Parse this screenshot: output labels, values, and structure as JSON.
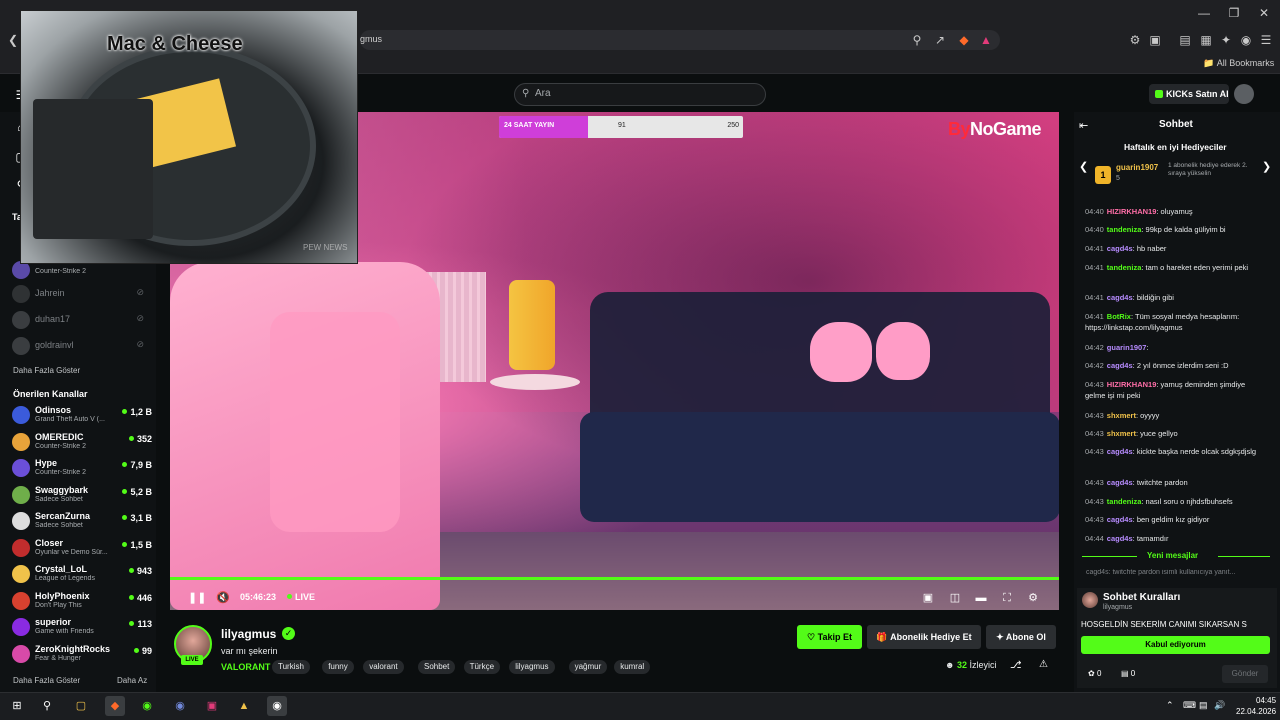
{
  "browser": {
    "url": "kick.com/lilyagmus",
    "url_visible": "gmus",
    "bookmarks_label": "All Bookmarks",
    "window_controls": [
      "minimize-icon",
      "restore-icon",
      "close-icon"
    ]
  },
  "topnav": {
    "search_placeholder": "Ara",
    "kicks_button": "KICKs Satın Al"
  },
  "pip": {
    "title": "Mac & Cheese",
    "watermark": "PEW NEWS"
  },
  "sidebar": {
    "following_header": "Ta",
    "following": [
      {
        "name": "",
        "category": "Counter-Strike 2",
        "live": true
      },
      {
        "name": "Jahrein",
        "live": false
      },
      {
        "name": "duhan17",
        "live": false
      },
      {
        "name": "goldrainvl",
        "live": false
      }
    ],
    "show_more": "Daha Fazla Göster",
    "recommended_header": "Önerilen Kanallar",
    "recommended": [
      {
        "name": "Odinsos",
        "category": "Grand Theft Auto V (...",
        "viewers": "1,2 B",
        "color": "#3b5bdb"
      },
      {
        "name": "OMEREDIC",
        "category": "Counter-Strike 2",
        "viewers": "352",
        "color": "#e8a33a"
      },
      {
        "name": "Hype",
        "category": "Counter-Strike 2",
        "viewers": "7,9 B",
        "color": "#6b4fd8"
      },
      {
        "name": "Swaggybark",
        "category": "Sadece Sohbet",
        "viewers": "5,2 B",
        "color": "#6fae4a"
      },
      {
        "name": "SercanZurna",
        "category": "Sadece Sohbet",
        "viewers": "3,1 B",
        "color": "#dddddd"
      },
      {
        "name": "Closer",
        "category": "Oyunlar ve Demo Sür...",
        "viewers": "1,5 B",
        "color": "#c22d2d"
      },
      {
        "name": "Crystal_LoL",
        "category": "League of Legends",
        "viewers": "943",
        "color": "#f0c24a"
      },
      {
        "name": "HolyPhoenix",
        "category": "Don't Play This",
        "viewers": "446",
        "color": "#d8412f"
      },
      {
        "name": "superior",
        "category": "Game with Friends",
        "viewers": "113",
        "color": "#8a2be2"
      },
      {
        "name": "ZeroKnightRocks",
        "category": "Fear & Hunger",
        "viewers": "99",
        "color": "#d84aa8"
      }
    ],
    "show_more_bottom": "Daha Fazla Göster",
    "show_less": "Daha Az"
  },
  "video": {
    "brand_prefix": "By",
    "brand_suffix": "NoGame",
    "goal": {
      "title": "24 SAAT YAYIN",
      "current": 91,
      "max": 250,
      "current_label": "91",
      "max_label": "250"
    },
    "time": "05:46:23",
    "live": "LIVE"
  },
  "channel": {
    "name": "lilyagmus",
    "title": "var mı şekerin",
    "game": "VALORANT",
    "live_badge": "LIVE",
    "tags": [
      "Turkish",
      "funny",
      "valorant",
      "Sohbet",
      "Türkçe",
      "lilyagmus",
      "yağmur",
      "kumral"
    ],
    "follow": "Takip Et",
    "gift": "Abonelik Hediye Et",
    "subscribe": "Abone Ol",
    "viewers_count": "32",
    "viewers_label": "İzleyici"
  },
  "chat": {
    "title": "Sohbet",
    "gifters_title": "Haftalık en iyi Hediyeciler",
    "top_gifter": "guarin1907",
    "top_gifter_count": "5",
    "gifter_hint": "1 abonelik hediye ederek 2. sıraya yükselin",
    "messages": [
      {
        "time": "04:40",
        "user": "HIZIRKHAN19",
        "color": "#ff6ea8",
        "text": "oluyamuş"
      },
      {
        "time": "04:40",
        "user": "tandeniza",
        "color": "#53fc18",
        "text": "99kp de kalda güliyim bi"
      },
      {
        "time": "04:41",
        "user": "cagd4s",
        "color": "#b78cff",
        "text": "hb naber"
      },
      {
        "time": "04:41",
        "user": "tandeniza",
        "color": "#53fc18",
        "text": "tam o hareket eden yerimi peki"
      },
      {
        "time": "04:41",
        "user": "cagd4s",
        "color": "#b78cff",
        "text": "bildiğin gibi"
      },
      {
        "time": "04:41",
        "user": "BotRix",
        "color": "#53fc18",
        "text": "Tüm sosyal medya hesaplarım: https://linkstap.com/lilyagmus"
      },
      {
        "time": "04:42",
        "user": "guarin1907",
        "color": "#b78cff",
        "text": ""
      },
      {
        "time": "04:42",
        "user": "cagd4s",
        "color": "#b78cff",
        "text": "2 yıl önmce izlerdim seni :D"
      },
      {
        "time": "04:43",
        "user": "HIZIRKHAN19",
        "color": "#ff6ea8",
        "text": "yamuş deminden şimdiye gelme işi mi peki"
      },
      {
        "time": "04:43",
        "user": "shxmert",
        "color": "#f0c24a",
        "text": "oyyyy"
      },
      {
        "time": "04:43",
        "user": "shxmert",
        "color": "#f0c24a",
        "text": "yuce gellyo"
      },
      {
        "time": "04:43",
        "user": "cagd4s",
        "color": "#b78cff",
        "text": "kickte başka nerde olcak sdgkşdjslg"
      },
      {
        "time": "04:43",
        "user": "cagd4s",
        "color": "#b78cff",
        "text": "twitchte pardon"
      },
      {
        "time": "04:43",
        "user": "tandeniza",
        "color": "#53fc18",
        "text": "nasıl soru o njhdsfbuhsefs"
      },
      {
        "time": "04:43",
        "user": "cagd4s",
        "color": "#b78cff",
        "text": "ben geldim kız gidiyor"
      },
      {
        "time": "04:44",
        "user": "cagd4s",
        "color": "#b78cff",
        "text": "tamamdır"
      }
    ],
    "new_messages": "Yeni mesajlar",
    "reply_preview": "cagd4s: twitchte pardon isimli kullanıcıya yanıt...",
    "rules_title": "Sohbet Kuralları",
    "rules_user": "lilyagmus",
    "rules_text": "HOSGELDİN SEKERİM CANIMI SIKARSAN S",
    "accept": "Kabul ediyorum",
    "points_a": "0",
    "points_b": "0",
    "send": "Gönder"
  },
  "taskbar": {
    "time": "04:45",
    "date": "22.04.2026"
  }
}
